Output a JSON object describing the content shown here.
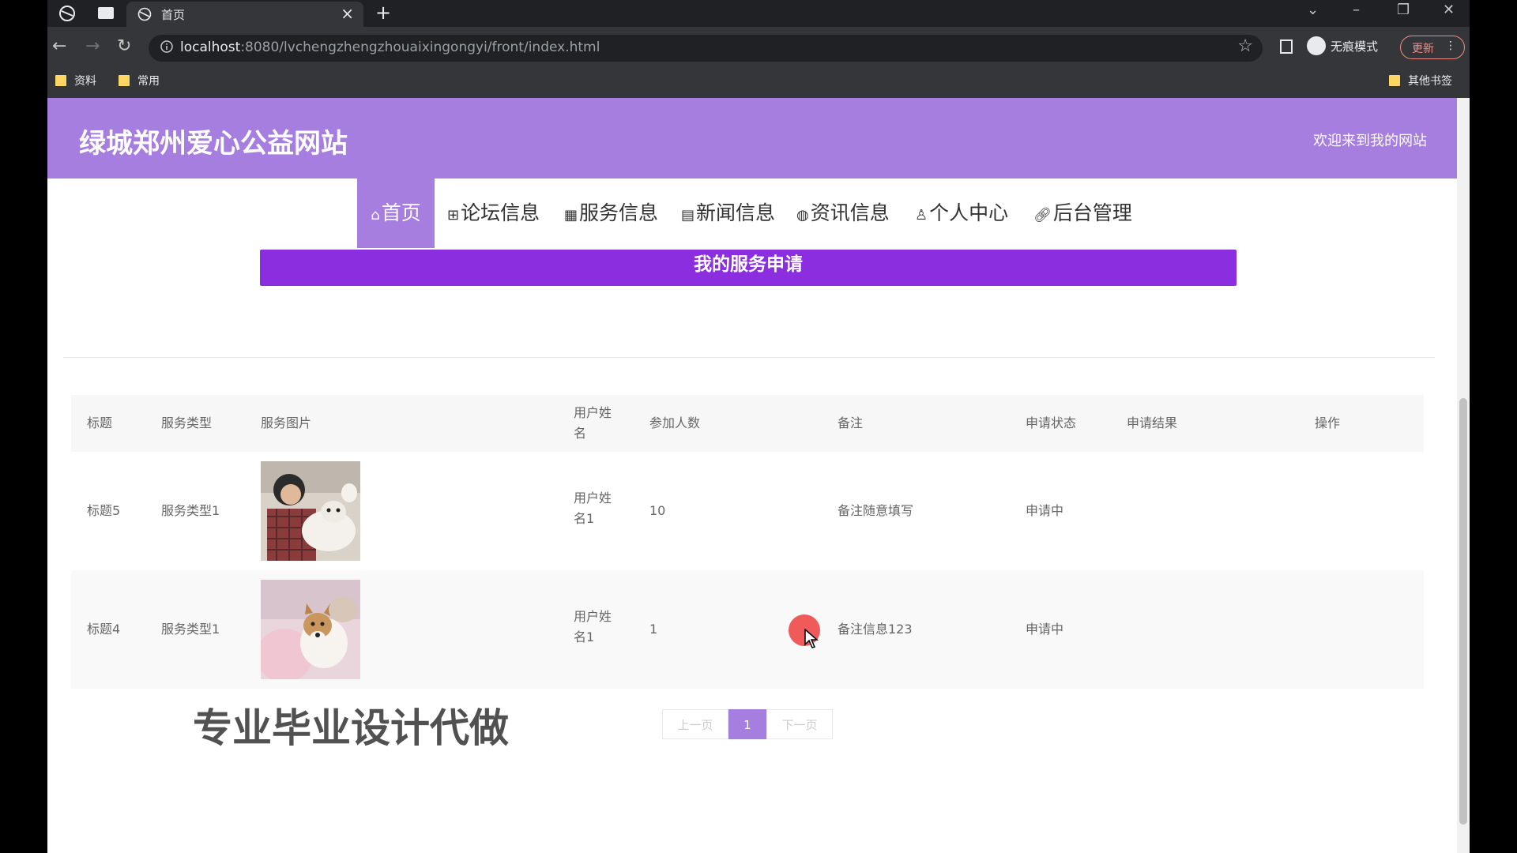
{
  "browser": {
    "tab_title": "首页",
    "url_host": "localhost",
    "url_path": ":8080/lvchengzhengzhouaixingongyi/front/index.html",
    "incognito_label": "无痕模式",
    "update_label": "更新",
    "bookmarks": [
      "资料",
      "常用"
    ],
    "other_bookmarks": "其他书签"
  },
  "site": {
    "title": "绿城郑州爱心公益网站",
    "welcome": "欢迎来到我的网站"
  },
  "nav": [
    {
      "label": "首页",
      "icon": "home-icon"
    },
    {
      "label": "论坛信息",
      "icon": "forum-icon"
    },
    {
      "label": "服务信息",
      "icon": "service-icon"
    },
    {
      "label": "新闻信息",
      "icon": "news-icon"
    },
    {
      "label": "资讯信息",
      "icon": "info-icon"
    },
    {
      "label": "个人中心",
      "icon": "user-icon"
    },
    {
      "label": "后台管理",
      "icon": "link-icon"
    }
  ],
  "banner": "我的服务申请",
  "table": {
    "headers": [
      "标题",
      "服务类型",
      "服务图片",
      "用户姓名",
      "参加人数",
      "备注",
      "申请状态",
      "申请结果",
      "操作"
    ],
    "rows": [
      {
        "title": "标题5",
        "type": "服务类型1",
        "user": "用户姓名1",
        "count": "10",
        "remark": "备注随意填写",
        "status": "申请中",
        "result": ""
      },
      {
        "title": "标题4",
        "type": "服务类型1",
        "user": "用户姓名1",
        "count": "1",
        "remark": "备注信息123",
        "status": "申请中",
        "result": ""
      }
    ]
  },
  "pager": {
    "prev": "上一页",
    "current": "1",
    "next": "下一页"
  },
  "watermark": "专业毕业设计代做",
  "colors": {
    "accent": "#a67ee0",
    "banner": "#8b2ee0"
  }
}
